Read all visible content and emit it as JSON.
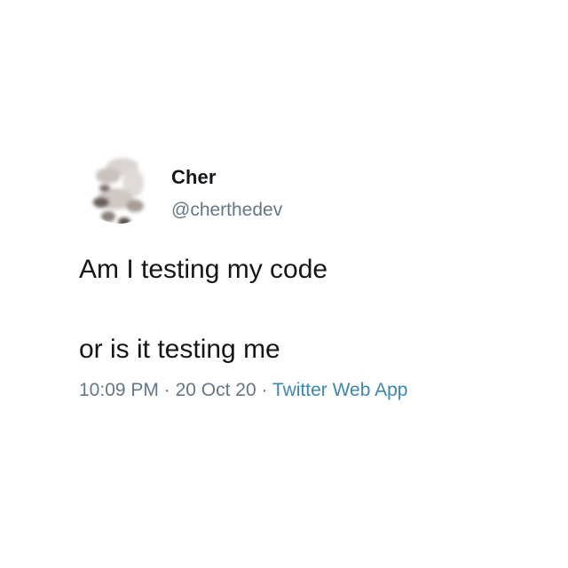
{
  "tweet": {
    "display_name": "Cher",
    "handle": "@cherthedev",
    "text_line_1": "Am I testing my code",
    "text_line_2": "or is it testing me",
    "time": "10:09 PM",
    "separator": " · ",
    "date": "20 Oct 20",
    "source": "Twitter Web App",
    "avatar_icon": "profile-avatar"
  },
  "colors": {
    "text_primary": "#14171a",
    "text_secondary": "#657786",
    "link": "#3a87b5",
    "background": "#ffffff"
  }
}
